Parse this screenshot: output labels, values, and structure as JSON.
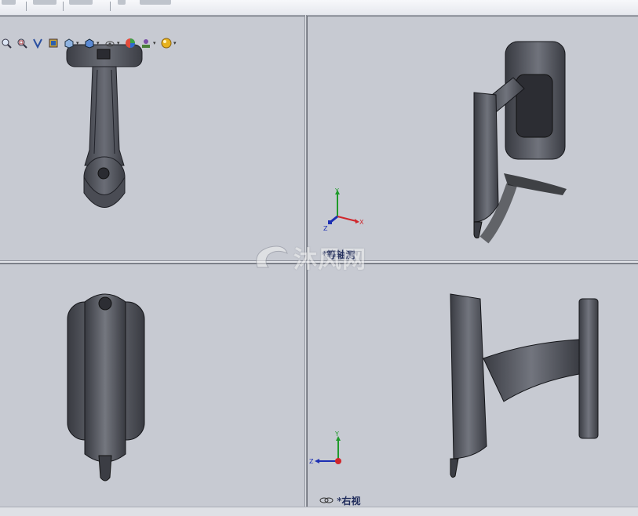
{
  "toolbar": {
    "icons": [
      "zoom-to-fit-icon",
      "zoom-to-area-icon",
      "previous-view-icon",
      "section-view-icon",
      "view-orientation-icon",
      "display-style-icon",
      "hide-show-items-icon",
      "edit-appearance-icon",
      "apply-scene-icon",
      "view-settings-icon"
    ]
  },
  "viewports": {
    "top_left": {
      "label": ""
    },
    "top_right": {
      "label": "*等轴测"
    },
    "bottom_left": {
      "label": ""
    },
    "bottom_right": {
      "label": "*右视"
    }
  },
  "triad": {
    "x": "X",
    "y": "Y",
    "z": "Z"
  },
  "watermark": {
    "text": "沐风网"
  },
  "colors": {
    "viewport_bg": "#c7cad2",
    "model": "#4b4d55",
    "axis_x": "#d0262b",
    "axis_y": "#1f9a2a",
    "axis_z": "#1c2fb3",
    "label": "#1e2a5a"
  }
}
